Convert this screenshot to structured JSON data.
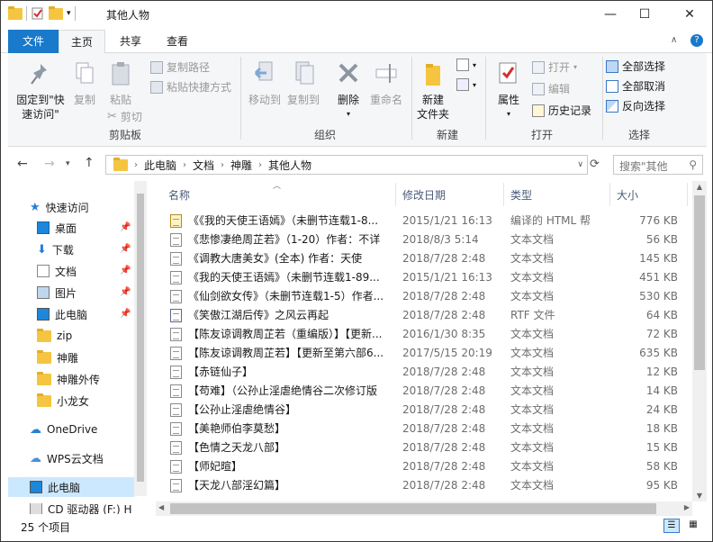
{
  "window": {
    "title": "其他人物"
  },
  "title_controls": {
    "minimize": "—",
    "maximize": "☐",
    "close": "✕"
  },
  "tabs": {
    "file": "文件",
    "home": "主页",
    "share": "共享",
    "view": "查看"
  },
  "ribbon": {
    "pin_quick": "固定到\"快\n速访问\"",
    "copy": "复制",
    "paste": "粘贴",
    "copy_path": "复制路径",
    "paste_shortcut": "粘贴快捷方式",
    "cut": "剪切",
    "group_clipboard": "剪贴板",
    "move_to": "移动到",
    "copy_to": "复制到",
    "delete": "删除",
    "rename": "重命名",
    "group_organize": "组织",
    "new_folder": "新建\n文件夹",
    "group_new": "新建",
    "properties": "属性",
    "open": "打开",
    "edit": "编辑",
    "history": "历史记录",
    "group_open": "打开",
    "select_all": "全部选择",
    "select_none": "全部取消",
    "invert_select": "反向选择",
    "group_select": "选择"
  },
  "address": {
    "crumbs": [
      "此电脑",
      "文档",
      "神雕",
      "其他人物"
    ],
    "search_placeholder": "搜索\"其他"
  },
  "nav": {
    "quick_access": "快速访问",
    "desktop": "桌面",
    "downloads": "下载",
    "documents": "文档",
    "pictures": "图片",
    "this_pc_pin": "此电脑",
    "zip": "zip",
    "shendiao": "神雕",
    "shendiao_waizhuan": "神雕外传",
    "xiaolongnv": "小龙女",
    "onedrive": "OneDrive",
    "wps": "WPS云文档",
    "this_pc": "此电脑",
    "cd_drive": "CD 驱动器 (F:) H"
  },
  "columns": {
    "name": "名称",
    "date": "修改日期",
    "type": "类型",
    "size": "大小"
  },
  "files": [
    {
      "name": "《《我的天使王语嫣》（未删节连载1-8...",
      "date": "2015/1/21 16:13",
      "type": "编译的 HTML 帮",
      "size": "776 KB",
      "icon": "chm-icon"
    },
    {
      "name": "《悲惨凄绝周芷若》（1-20）作者：不详",
      "date": "2018/8/3 5:14",
      "type": "文本文档",
      "size": "56 KB",
      "icon": "txt-icon"
    },
    {
      "name": "《调教大唐美女》(全本) 作者：天使",
      "date": "2018/7/28 2:48",
      "type": "文本文档",
      "size": "145 KB",
      "icon": "txt-icon"
    },
    {
      "name": "《我的天使王语嫣》（未删节连载1-89...",
      "date": "2015/1/21 16:13",
      "type": "文本文档",
      "size": "451 KB",
      "icon": "txt-icon"
    },
    {
      "name": "《仙剑欲女传》（未删节连载1-5）作者...",
      "date": "2018/7/28 2:48",
      "type": "文本文档",
      "size": "530 KB",
      "icon": "txt-icon"
    },
    {
      "name": "《笑傲江湖后传》之风云再起",
      "date": "2018/7/28 2:48",
      "type": "RTF 文件",
      "size": "64 KB",
      "icon": "rtf-icon"
    },
    {
      "name": "【陈友谅调教周芷若（重编版）】【更新...",
      "date": "2016/1/30 8:35",
      "type": "文本文档",
      "size": "72 KB",
      "icon": "txt-icon"
    },
    {
      "name": "【陈友谅调教周芷若】【更新至第六部6...",
      "date": "2017/5/15 20:19",
      "type": "文本文档",
      "size": "635 KB",
      "icon": "txt-icon"
    },
    {
      "name": "【赤链仙子】",
      "date": "2018/7/28 2:48",
      "type": "文本文档",
      "size": "12 KB",
      "icon": "txt-icon"
    },
    {
      "name": "【苟难】（公孙止淫虐绝情谷二次修订版",
      "date": "2018/7/28 2:48",
      "type": "文本文档",
      "size": "14 KB",
      "icon": "txt-icon"
    },
    {
      "name": "【公孙止淫虐绝情谷】",
      "date": "2018/7/28 2:48",
      "type": "文本文档",
      "size": "24 KB",
      "icon": "txt-icon"
    },
    {
      "name": "【美艳师伯李莫愁】",
      "date": "2018/7/28 2:48",
      "type": "文本文档",
      "size": "18 KB",
      "icon": "txt-icon"
    },
    {
      "name": "【色情之天龙八部】",
      "date": "2018/7/28 2:48",
      "type": "文本文档",
      "size": "15 KB",
      "icon": "txt-icon"
    },
    {
      "name": "【师妃暄】",
      "date": "2018/7/28 2:48",
      "type": "文本文档",
      "size": "58 KB",
      "icon": "txt-icon"
    },
    {
      "name": "【天龙八部淫幻篇】",
      "date": "2018/7/28 2:48",
      "type": "文本文档",
      "size": "95 KB",
      "icon": "txt-icon"
    }
  ],
  "status": {
    "count": "25 个项目"
  },
  "colors": {
    "accent": "#1979ca",
    "selected": "#cce8ff",
    "folder": "#f5c542"
  }
}
